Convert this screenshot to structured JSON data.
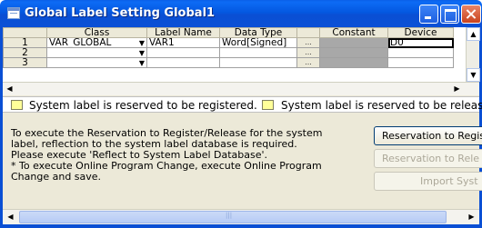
{
  "window": {
    "title": "Global Label Setting Global1"
  },
  "grid": {
    "columns": [
      "",
      "Class",
      "Label Name",
      "Data Type",
      "",
      "Constant",
      "Device"
    ],
    "rows": [
      {
        "num": "1",
        "class": "VAR_GLOBAL",
        "label": "VAR1",
        "datatype": "Word[Signed]",
        "ellipsis": "...",
        "constant": "",
        "device": "D0"
      },
      {
        "num": "2",
        "class": "",
        "label": "",
        "datatype": "",
        "ellipsis": "...",
        "constant": "",
        "device": ""
      },
      {
        "num": "3",
        "class": "",
        "label": "",
        "datatype": "",
        "ellipsis": "...",
        "constant": "",
        "device": ""
      }
    ]
  },
  "legend": {
    "registered": "System label is reserved to be registered.",
    "released": "System label is reserved to be released."
  },
  "message": {
    "lines": [
      "To execute the Reservation to Register/Release for the system",
      "label, reflection to the system label database is required.",
      "Please execute 'Reflect to System Label Database'.",
      "* To execute Online Program Change, execute Online Program",
      "Change and save."
    ]
  },
  "buttons": {
    "reserve_register": "Reservation to Regis",
    "reserve_release": "Reservation to Rele",
    "import_system": "Import Syst"
  },
  "icons": {
    "dropdown": "▼",
    "scroll_up": "▲",
    "scroll_down": "▼",
    "scroll_left": "◀",
    "scroll_right": "▶"
  },
  "colors": {
    "title_bar": "#0a5fe8",
    "legend_swatch": "#ffff99",
    "constant_cell": "#a8a8a8"
  }
}
